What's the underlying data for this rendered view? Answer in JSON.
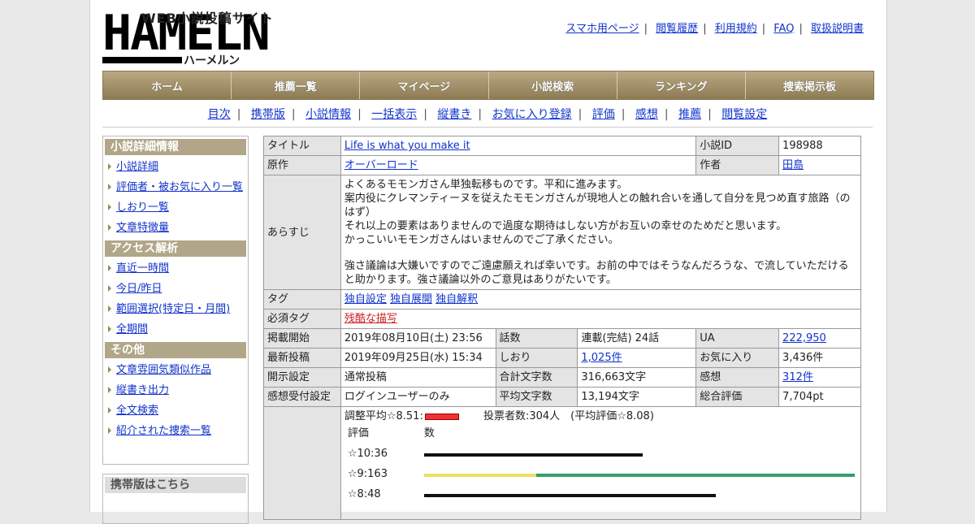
{
  "site": {
    "logo_big": "HAMELN",
    "logo_sub": "WEB小説投稿サイト",
    "logo_kana": "ハーメルン"
  },
  "top_links": [
    "スマホ用ページ",
    "閲覧履歴",
    "利用規約",
    "FAQ",
    "取扱説明書"
  ],
  "global_nav": [
    "ホーム",
    "推薦一覧",
    "マイページ",
    "小説検索",
    "ランキング",
    "捜索掲示板"
  ],
  "sub_nav": [
    "目次",
    "携帯版",
    "小説情報",
    "一括表示",
    "縦書き",
    "お気に入り登録",
    "評価",
    "感想",
    "推薦",
    "閲覧設定"
  ],
  "sidebar": {
    "sections": [
      {
        "title": "小説詳細情報",
        "items": [
          "小説詳細",
          "評価者・被お気に入り一覧",
          "しおり一覧",
          "文章特徴量"
        ]
      },
      {
        "title": "アクセス解析",
        "items": [
          "直近一時間",
          "今日/昨日",
          "範囲選択(特定日・月間)",
          "全期間"
        ]
      },
      {
        "title": "その他",
        "items": [
          "文章雰囲気類似作品",
          "縦書き出力",
          "全文検索",
          "紹介された捜索一覧"
        ]
      }
    ],
    "mobile_title": "携帯版はこちら"
  },
  "info": {
    "title_label": "タイトル",
    "title_value": "Life is what you make it",
    "novel_id_label": "小説ID",
    "novel_id_value": "198988",
    "original_label": "原作",
    "original_value": "オーバーロード",
    "author_label": "作者",
    "author_value": "田島",
    "synopsis_label": "あらすじ",
    "synopsis_lines": [
      "よくあるモモンガさん単独転移ものです。平和に進みます。",
      "案内役にクレマンティーヌを従えたモモンガさんが現地人との触れ合いを通して自分を見つめ直す旅路（のはず）",
      "それ以上の要素はありませんので過度な期待はしない方がお互いの幸せのためだと思います。",
      "かっこいいモモンガさんはいませんのでご了承ください。",
      "",
      "強さ議論は大嫌いですのでご遠慮願えれば幸いです。お前の中ではそうなんだろうな、で流していただけると助かります。強さ議論以外のご意見はありがたいです。"
    ],
    "tags_label": "タグ",
    "tags": [
      "独自設定",
      "独自展開",
      "独自解釈"
    ],
    "required_tags_label": "必須タグ",
    "required_tags": [
      "残酷な描写"
    ],
    "rows": [
      [
        "掲載開始",
        "2019年08月10日(土) 23:56",
        "話数",
        "連載(完結) 24話",
        "UA",
        "222,950"
      ],
      [
        "最新投稿",
        "2019年09月25日(水) 15:34",
        "しおり",
        "1,025件",
        "お気に入り",
        "3,436件"
      ],
      [
        "開示設定",
        "通常投稿",
        "合計文字数",
        "316,663文字",
        "感想",
        "312件"
      ],
      [
        "感想受付設定",
        "ログインユーザーのみ",
        "平均文字数",
        "13,194文字",
        "総合評価",
        "7,704pt"
      ]
    ],
    "rating_avg": "調整平均☆8.51:",
    "rating_voters": "投票者数:304人　(平均評価☆8.08)",
    "rating_head_left": "評価",
    "rating_head_right": "数",
    "ratings": [
      {
        "label": "☆10:36",
        "value": 36
      },
      {
        "label": "☆9:163",
        "value": 163
      },
      {
        "label": "☆8:48",
        "value": 48
      }
    ]
  },
  "colors": {
    "nav_top": "#b9a882",
    "side_head": "#b1a688",
    "link": "#1133cc",
    "warn": "#cc2222"
  }
}
